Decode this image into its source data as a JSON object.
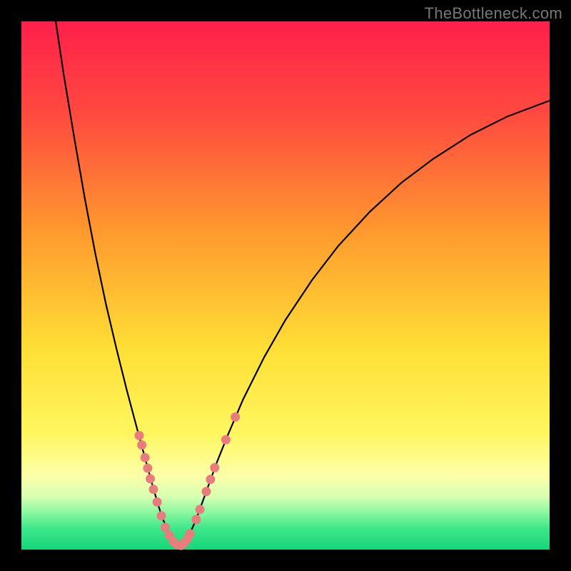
{
  "watermark": "TheBottleneck.com",
  "colors": {
    "frame": "#000000",
    "curve_stroke": "#000000",
    "marker_fill": "#e77d7d",
    "marker_stroke": "#c85f5f"
  },
  "chart_data": {
    "type": "line",
    "title": "",
    "xlabel": "",
    "ylabel": "",
    "xlim": [
      0,
      100
    ],
    "ylim": [
      0,
      100
    ],
    "grid": false,
    "curve": [
      {
        "x": 6.5,
        "y": 100.0
      },
      {
        "x": 8.0,
        "y": 90.0
      },
      {
        "x": 10.0,
        "y": 78.0
      },
      {
        "x": 12.0,
        "y": 66.5
      },
      {
        "x": 14.0,
        "y": 56.0
      },
      {
        "x": 16.0,
        "y": 46.5
      },
      {
        "x": 18.0,
        "y": 38.0
      },
      {
        "x": 20.0,
        "y": 30.0
      },
      {
        "x": 22.0,
        "y": 22.5
      },
      {
        "x": 23.5,
        "y": 17.0
      },
      {
        "x": 25.0,
        "y": 11.5
      },
      {
        "x": 26.5,
        "y": 6.5
      },
      {
        "x": 28.0,
        "y": 2.8
      },
      {
        "x": 29.3,
        "y": 0.8
      },
      {
        "x": 30.5,
        "y": 0.8
      },
      {
        "x": 31.5,
        "y": 2.2
      },
      {
        "x": 33.0,
        "y": 5.5
      },
      {
        "x": 35.0,
        "y": 11.0
      },
      {
        "x": 37.0,
        "y": 16.5
      },
      {
        "x": 39.0,
        "y": 21.5
      },
      {
        "x": 42.0,
        "y": 28.5
      },
      {
        "x": 46.0,
        "y": 36.5
      },
      {
        "x": 50.0,
        "y": 43.5
      },
      {
        "x": 55.0,
        "y": 51.0
      },
      {
        "x": 60.0,
        "y": 57.5
      },
      {
        "x": 66.0,
        "y": 64.0
      },
      {
        "x": 72.0,
        "y": 69.5
      },
      {
        "x": 78.0,
        "y": 74.0
      },
      {
        "x": 85.0,
        "y": 78.5
      },
      {
        "x": 92.0,
        "y": 82.0
      },
      {
        "x": 100.0,
        "y": 85.0
      }
    ],
    "markers": [
      {
        "x": 22.3,
        "y": 21.6
      },
      {
        "x": 22.8,
        "y": 19.8
      },
      {
        "x": 23.4,
        "y": 17.4
      },
      {
        "x": 23.9,
        "y": 15.4
      },
      {
        "x": 24.4,
        "y": 13.4
      },
      {
        "x": 25.0,
        "y": 11.4
      },
      {
        "x": 25.7,
        "y": 9.0
      },
      {
        "x": 26.5,
        "y": 6.4
      },
      {
        "x": 27.2,
        "y": 4.2
      },
      {
        "x": 28.0,
        "y": 2.7
      },
      {
        "x": 28.8,
        "y": 1.5
      },
      {
        "x": 29.5,
        "y": 0.9
      },
      {
        "x": 30.2,
        "y": 0.8
      },
      {
        "x": 30.8,
        "y": 1.2
      },
      {
        "x": 31.4,
        "y": 2.0
      },
      {
        "x": 31.9,
        "y": 3.0
      },
      {
        "x": 33.1,
        "y": 5.7
      },
      {
        "x": 33.8,
        "y": 7.6
      },
      {
        "x": 35.0,
        "y": 11.0
      },
      {
        "x": 35.8,
        "y": 13.3
      },
      {
        "x": 36.6,
        "y": 15.5
      },
      {
        "x": 38.7,
        "y": 20.8
      },
      {
        "x": 40.5,
        "y": 25.1
      }
    ]
  }
}
